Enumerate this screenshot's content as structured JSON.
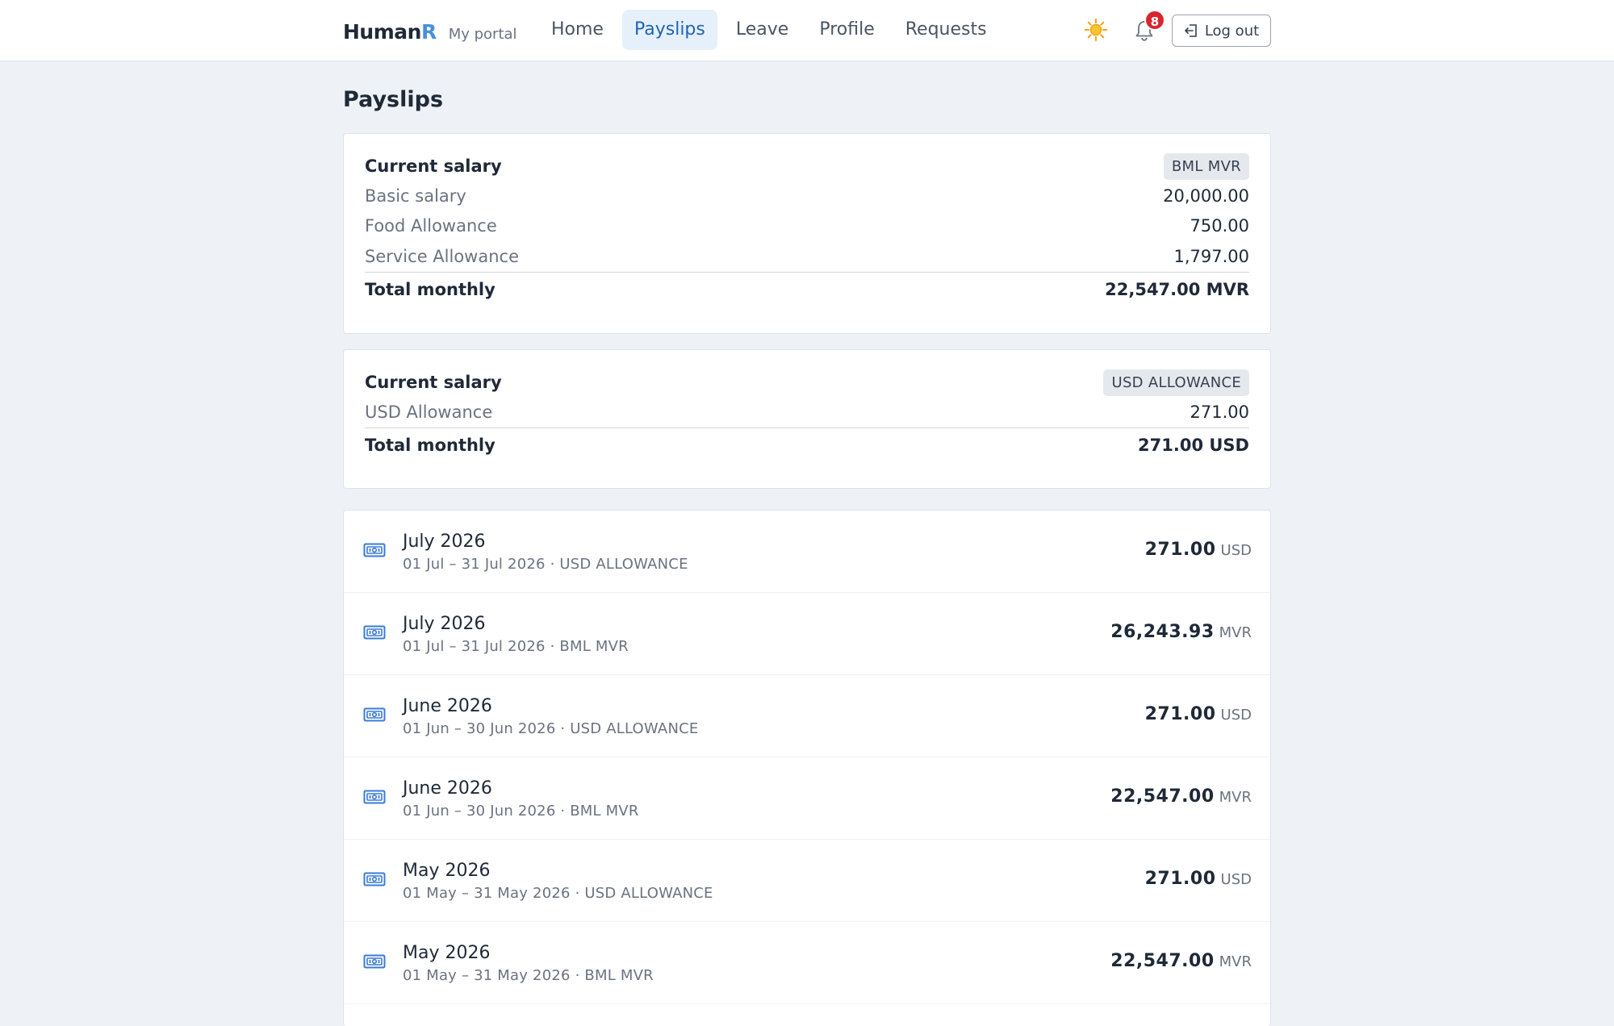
{
  "brand": {
    "name": "Human",
    "name_accent": "R",
    "subtitle": "My portal"
  },
  "nav": {
    "home": "Home",
    "payslips": "Payslips",
    "leave": "Leave",
    "profile": "Profile",
    "requests": "Requests"
  },
  "header": {
    "notification_count": "8",
    "logout_label": "Log out",
    "theme_icon": "sun-icon",
    "bell_icon": "bell-icon"
  },
  "page": {
    "title": "Payslips"
  },
  "salary_cards": [
    {
      "title": "Current salary",
      "tag": "BML MVR",
      "rows": [
        {
          "label": "Basic salary",
          "value": "20,000.00"
        },
        {
          "label": "Food Allowance",
          "value": "750.00"
        },
        {
          "label": "Service Allowance",
          "value": "1,797.00"
        }
      ],
      "total_label": "Total monthly",
      "total_value": "22,547.00 MVR"
    },
    {
      "title": "Current salary",
      "tag": "USD ALLOWANCE",
      "rows": [
        {
          "label": "USD Allowance",
          "value": "271.00"
        }
      ],
      "total_label": "Total monthly",
      "total_value": "271.00 USD"
    }
  ],
  "payslips": [
    {
      "title": "July 2026",
      "subtitle": "01 Jul – 31 Jul 2026 · USD ALLOWANCE",
      "amount": "271.00",
      "currency": "USD"
    },
    {
      "title": "July 2026",
      "subtitle": "01 Jul – 31 Jul 2026 · BML MVR",
      "amount": "26,243.93",
      "currency": "MVR"
    },
    {
      "title": "June 2026",
      "subtitle": "01 Jun – 30 Jun 2026 · USD ALLOWANCE",
      "amount": "271.00",
      "currency": "USD"
    },
    {
      "title": "June 2026",
      "subtitle": "01 Jun – 30 Jun 2026 · BML MVR",
      "amount": "22,547.00",
      "currency": "MVR"
    },
    {
      "title": "May 2026",
      "subtitle": "01 May – 31 May 2026 · USD ALLOWANCE",
      "amount": "271.00",
      "currency": "USD"
    },
    {
      "title": "May 2026",
      "subtitle": "01 May – 31 May 2026 · BML MVR",
      "amount": "22,547.00",
      "currency": "MVR"
    }
  ],
  "colors": {
    "accent": "#1e63b8",
    "brand_accent": "#4a90d9",
    "badge": "#d7262e",
    "background": "#eef2f7"
  }
}
